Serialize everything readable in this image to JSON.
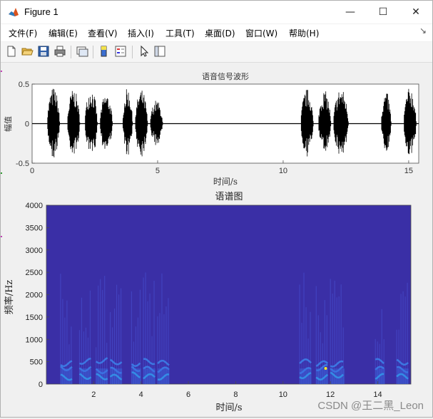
{
  "window": {
    "title": "Figure 1",
    "controls": {
      "minimize": "—",
      "maximize": "☐",
      "close": "✕"
    }
  },
  "menu": {
    "items": [
      "文件(F)",
      "编辑(E)",
      "查看(V)",
      "插入(I)",
      "工具(T)",
      "桌面(D)",
      "窗口(W)",
      "帮助(H)"
    ],
    "overflow": "↘"
  },
  "toolbar": {
    "icons": [
      "new-file-icon",
      "open-folder-icon",
      "save-icon",
      "print-icon",
      "link-plot-icon",
      "colorbar-icon",
      "legend-icon",
      "pointer-icon",
      "property-editor-icon"
    ]
  },
  "watermark": "CSDN @王二黑_Leon",
  "colors": {
    "waveform": "#000000",
    "spectrogram_bg": "#3a2fa6",
    "spectrogram_hot": "#f5e62a"
  },
  "chart_data": [
    {
      "type": "line",
      "title": "语音信号波形",
      "xlabel": "时间/s",
      "ylabel": "幅值",
      "xlim": [
        0,
        15.4
      ],
      "ylim": [
        -0.5,
        0.5
      ],
      "xticks": [
        0,
        5,
        10,
        15
      ],
      "yticks": [
        -0.5,
        0,
        0.5
      ],
      "tick_labels_x": [
        "0",
        "5",
        "10",
        "15"
      ],
      "tick_labels_y": [
        "-0.5",
        "0",
        "0.5"
      ],
      "speech_bursts": [
        {
          "start": 0.6,
          "end": 1.1,
          "amp": 0.46
        },
        {
          "start": 1.4,
          "end": 1.9,
          "amp": 0.44
        },
        {
          "start": 2.1,
          "end": 2.6,
          "amp": 0.45
        },
        {
          "start": 2.7,
          "end": 3.2,
          "amp": 0.38
        },
        {
          "start": 3.6,
          "end": 4.0,
          "amp": 0.45
        },
        {
          "start": 4.1,
          "end": 4.6,
          "amp": 0.43
        },
        {
          "start": 4.7,
          "end": 5.2,
          "amp": 0.3
        },
        {
          "start": 10.7,
          "end": 11.2,
          "amp": 0.44
        },
        {
          "start": 11.4,
          "end": 11.9,
          "amp": 0.42
        },
        {
          "start": 12.0,
          "end": 12.6,
          "amp": 0.45
        },
        {
          "start": 13.9,
          "end": 14.3,
          "amp": 0.4
        },
        {
          "start": 14.8,
          "end": 15.3,
          "amp": 0.46
        }
      ]
    },
    {
      "type": "heatmap",
      "title": "语谱图",
      "xlabel": "时间/s",
      "ylabel": "频率/Hz",
      "xlim": [
        0,
        15.4
      ],
      "ylim": [
        0,
        4000
      ],
      "xticks": [
        2,
        4,
        6,
        8,
        10,
        12,
        14
      ],
      "yticks": [
        0,
        500,
        1000,
        1500,
        2000,
        2500,
        3000,
        3500,
        4000
      ],
      "tick_labels_x": [
        "2",
        "4",
        "6",
        "8",
        "10",
        "12",
        "14"
      ],
      "tick_labels_y": [
        "0",
        "500",
        "1000",
        "1500",
        "2000",
        "2500",
        "3000",
        "3500",
        "4000"
      ],
      "energy_bursts": [
        {
          "start": 0.6,
          "end": 1.1
        },
        {
          "start": 1.4,
          "end": 1.9
        },
        {
          "start": 2.1,
          "end": 2.6
        },
        {
          "start": 2.7,
          "end": 3.2
        },
        {
          "start": 3.6,
          "end": 4.0
        },
        {
          "start": 4.1,
          "end": 4.6
        },
        {
          "start": 4.7,
          "end": 5.2
        },
        {
          "start": 10.7,
          "end": 11.2
        },
        {
          "start": 11.4,
          "end": 11.9
        },
        {
          "start": 12.0,
          "end": 12.6
        },
        {
          "start": 13.9,
          "end": 14.3
        },
        {
          "start": 14.8,
          "end": 15.3
        }
      ]
    }
  ]
}
